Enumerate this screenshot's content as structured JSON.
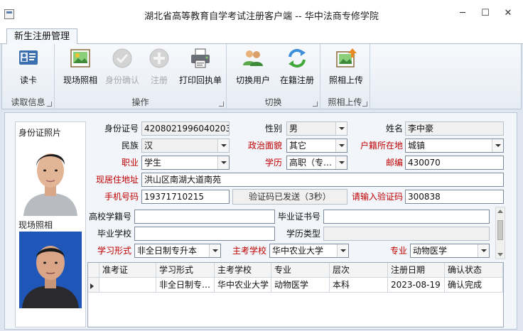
{
  "window": {
    "title": "湖北省高等教育自学考试注册客户端 -- 华中法商专修学院",
    "minimize": "─",
    "maximize": "☐",
    "close": "✕"
  },
  "tab": {
    "label": "新生注册管理"
  },
  "ribbon": {
    "groups": [
      {
        "label": "读取信息",
        "buttons": [
          {
            "label": "读卡",
            "icon": "id-card-reader-icon",
            "enabled": true
          }
        ]
      },
      {
        "label": "操作",
        "buttons": [
          {
            "label": "现场照相",
            "icon": "photo-icon",
            "enabled": true
          },
          {
            "label": "身份确认",
            "icon": "check-icon",
            "enabled": false
          },
          {
            "label": "注册",
            "icon": "plus-icon",
            "enabled": false
          },
          {
            "label": "打印回执单",
            "icon": "printer-icon",
            "enabled": true
          }
        ]
      },
      {
        "label": "切换",
        "buttons": [
          {
            "label": "切换用户",
            "icon": "users-icon",
            "enabled": true
          },
          {
            "label": "在籍注册",
            "icon": "refresh-icon",
            "enabled": true
          }
        ]
      },
      {
        "label": "照相上传",
        "buttons": [
          {
            "label": "照相上传",
            "icon": "photo-upload-icon",
            "enabled": true
          }
        ]
      }
    ]
  },
  "photos": {
    "id_caption": "身份证照片",
    "live_caption": "现场照相"
  },
  "form": {
    "id_number": {
      "label": "身份证号",
      "value": "4208021996040203"
    },
    "gender": {
      "label": "性别",
      "value": "男"
    },
    "name": {
      "label": "姓名",
      "value": "李中豪"
    },
    "ethnicity": {
      "label": "民族",
      "value": "汉"
    },
    "political_status": {
      "label": "政治面貌",
      "value": "其它"
    },
    "hukou": {
      "label": "户籍所在地",
      "value": "城镇"
    },
    "occupation": {
      "label": "职业",
      "value": "学生"
    },
    "education": {
      "label": "学历",
      "value": "高职（专…"
    },
    "postcode": {
      "label": "邮编",
      "value": "430070"
    },
    "address": {
      "label": "现居住地址",
      "value": "洪山区南湖大道南苑"
    },
    "phone": {
      "label": "手机号码",
      "value": "19371710215"
    },
    "verify_button": "验证码已发送（3秒）",
    "verify_code": {
      "label": "请输入验证码",
      "value": "300838"
    },
    "school_no": {
      "label": "高校学籍号",
      "value": ""
    },
    "cert_no": {
      "label": "毕业证书号",
      "value": ""
    },
    "grad_school": {
      "label": "毕业学校",
      "value": ""
    },
    "school_type": {
      "label": "学历类型",
      "value": ""
    },
    "study_mode": {
      "label": "学习形式",
      "value": "非全日制专升本"
    },
    "main_school": {
      "label": "主考学校",
      "value": "华中农业大学"
    },
    "major": {
      "label": "专业",
      "value": "动物医学"
    }
  },
  "table": {
    "columns": [
      "准考证",
      "学习形式",
      "主考学校",
      "专业",
      "层次",
      "注册日期",
      "确认状态"
    ],
    "rows": [
      [
        "",
        "非全日制专…",
        "华中农业大学",
        "动物医学",
        "本科",
        "2023-08-19",
        "确认完成"
      ]
    ]
  }
}
